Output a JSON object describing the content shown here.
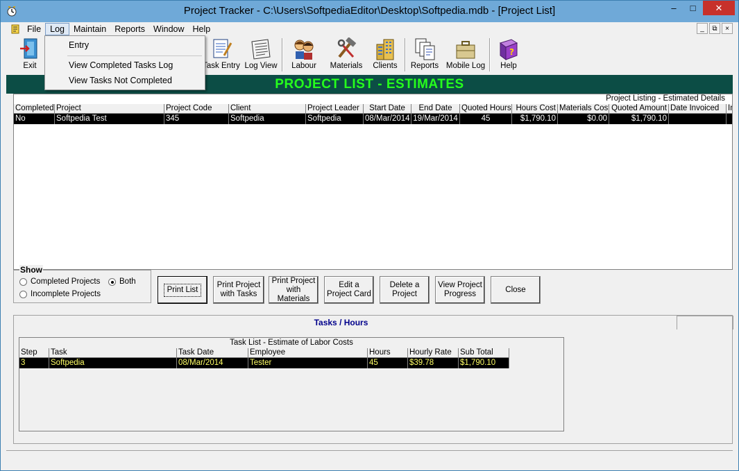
{
  "window": {
    "title": "Project Tracker - C:\\Users\\SoftpediaEditor\\Desktop\\Softpedia.mdb - [Project List]",
    "min": "–",
    "max": "□",
    "close": "✕"
  },
  "menu": {
    "items": [
      "File",
      "Log",
      "Maintain",
      "Reports",
      "Window",
      "Help"
    ],
    "mdi_min": "_",
    "mdi_restore": "⧉",
    "mdi_close": "×"
  },
  "log_menu": {
    "items": [
      "Entry",
      "View Completed Tasks Log",
      "View Tasks Not Completed"
    ]
  },
  "toolbar": {
    "exit": "Exit",
    "task_entry": "Task Entry",
    "log_view": "Log View",
    "labour": "Labour",
    "materials": "Materials",
    "clients": "Clients",
    "reports": "Reports",
    "mobile_log": "Mobile Log",
    "help": "Help",
    "icons": [
      "exit-door-icon",
      "task-entry-icon",
      "log-view-icon",
      "labour-people-icon",
      "materials-tools-icon",
      "clients-building-icon",
      "reports-docs-icon",
      "mobile-log-briefcase-icon",
      "help-book-icon"
    ]
  },
  "banner": "PROJECT   LIST - ESTIMATES",
  "project_grid": {
    "caption": "Project Listing - Estimated Details",
    "columns": [
      "Completed",
      "Project",
      "Project Code",
      "Client",
      "Project Leader",
      "Start Date",
      "End Date",
      "Quoted Hours",
      "Hours Cost",
      "Materials Cost",
      "Quoted Amount",
      "Date Invoiced",
      "In"
    ],
    "row": [
      "No",
      "Softpedia Test",
      "345",
      "Softpedia",
      "Softpedia",
      "08/Mar/2014",
      "19/Mar/2014",
      "45",
      "$1,790.10",
      "$0.00",
      "$1,790.10",
      "",
      ""
    ]
  },
  "show": {
    "legend": "Show",
    "completed": "Completed Projects",
    "incomplete": "Incomplete Projects",
    "both": "Both"
  },
  "buttons": {
    "print_list": "Print List",
    "print_tasks_1": "Print Project",
    "print_tasks_2": "with Tasks",
    "print_materials_1": "Print Project",
    "print_materials_2": "with Materials",
    "edit_1": "Edit a",
    "edit_2": "Project Card",
    "delete_1": "Delete a",
    "delete_2": "Project",
    "view_1": "View  Project",
    "view_2": "Progress",
    "close": "Close"
  },
  "tasks_tab": {
    "title": "Tasks / Hours",
    "caption": "Task List - Estimate of Labor Costs",
    "columns": [
      "Step",
      "Task",
      "Task Date",
      "Employee",
      "Hours",
      "Hourly Rate",
      "Sub Total"
    ],
    "row": [
      "3",
      "Softpedia",
      "08/Mar/2014",
      "Tester",
      "45",
      "$39.78",
      "$1,790.10"
    ]
  },
  "colors": {
    "banner_bg": "#0c4d45",
    "banner_text": "#26ff1c",
    "title_bar": "#6fa9d8",
    "close_button": "#c7312b"
  }
}
